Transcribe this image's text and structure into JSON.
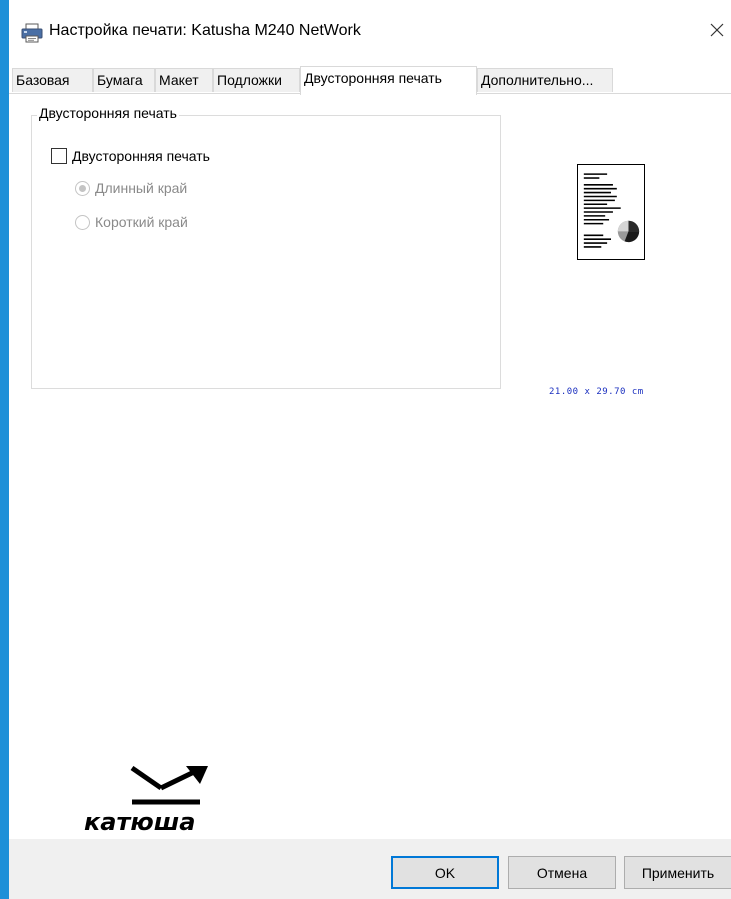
{
  "window": {
    "title": "Настройка печати: Katusha M240 NetWork",
    "accent_color": "#1e90d8"
  },
  "tabs": [
    {
      "label": "Базовая",
      "active": false
    },
    {
      "label": "Бумага",
      "active": false
    },
    {
      "label": "Макет",
      "active": false
    },
    {
      "label": "Подложки",
      "active": false
    },
    {
      "label": "Двусторонняя печать",
      "active": true
    },
    {
      "label": "Дополнительно...",
      "active": false
    }
  ],
  "duplex_group": {
    "title": "Двусторонняя печать",
    "checkbox_label": "Двусторонняя печать",
    "checkbox_checked": false,
    "options": [
      {
        "label": "Длинный край",
        "selected": true,
        "enabled": false
      },
      {
        "label": "Короткий край",
        "selected": false,
        "enabled": false
      }
    ]
  },
  "preview": {
    "paper_size": "21.00 x 29.70 cm"
  },
  "logo": {
    "text": "катюша"
  },
  "buttons": {
    "ok": "OK",
    "cancel": "Отмена",
    "apply": "Применить"
  }
}
